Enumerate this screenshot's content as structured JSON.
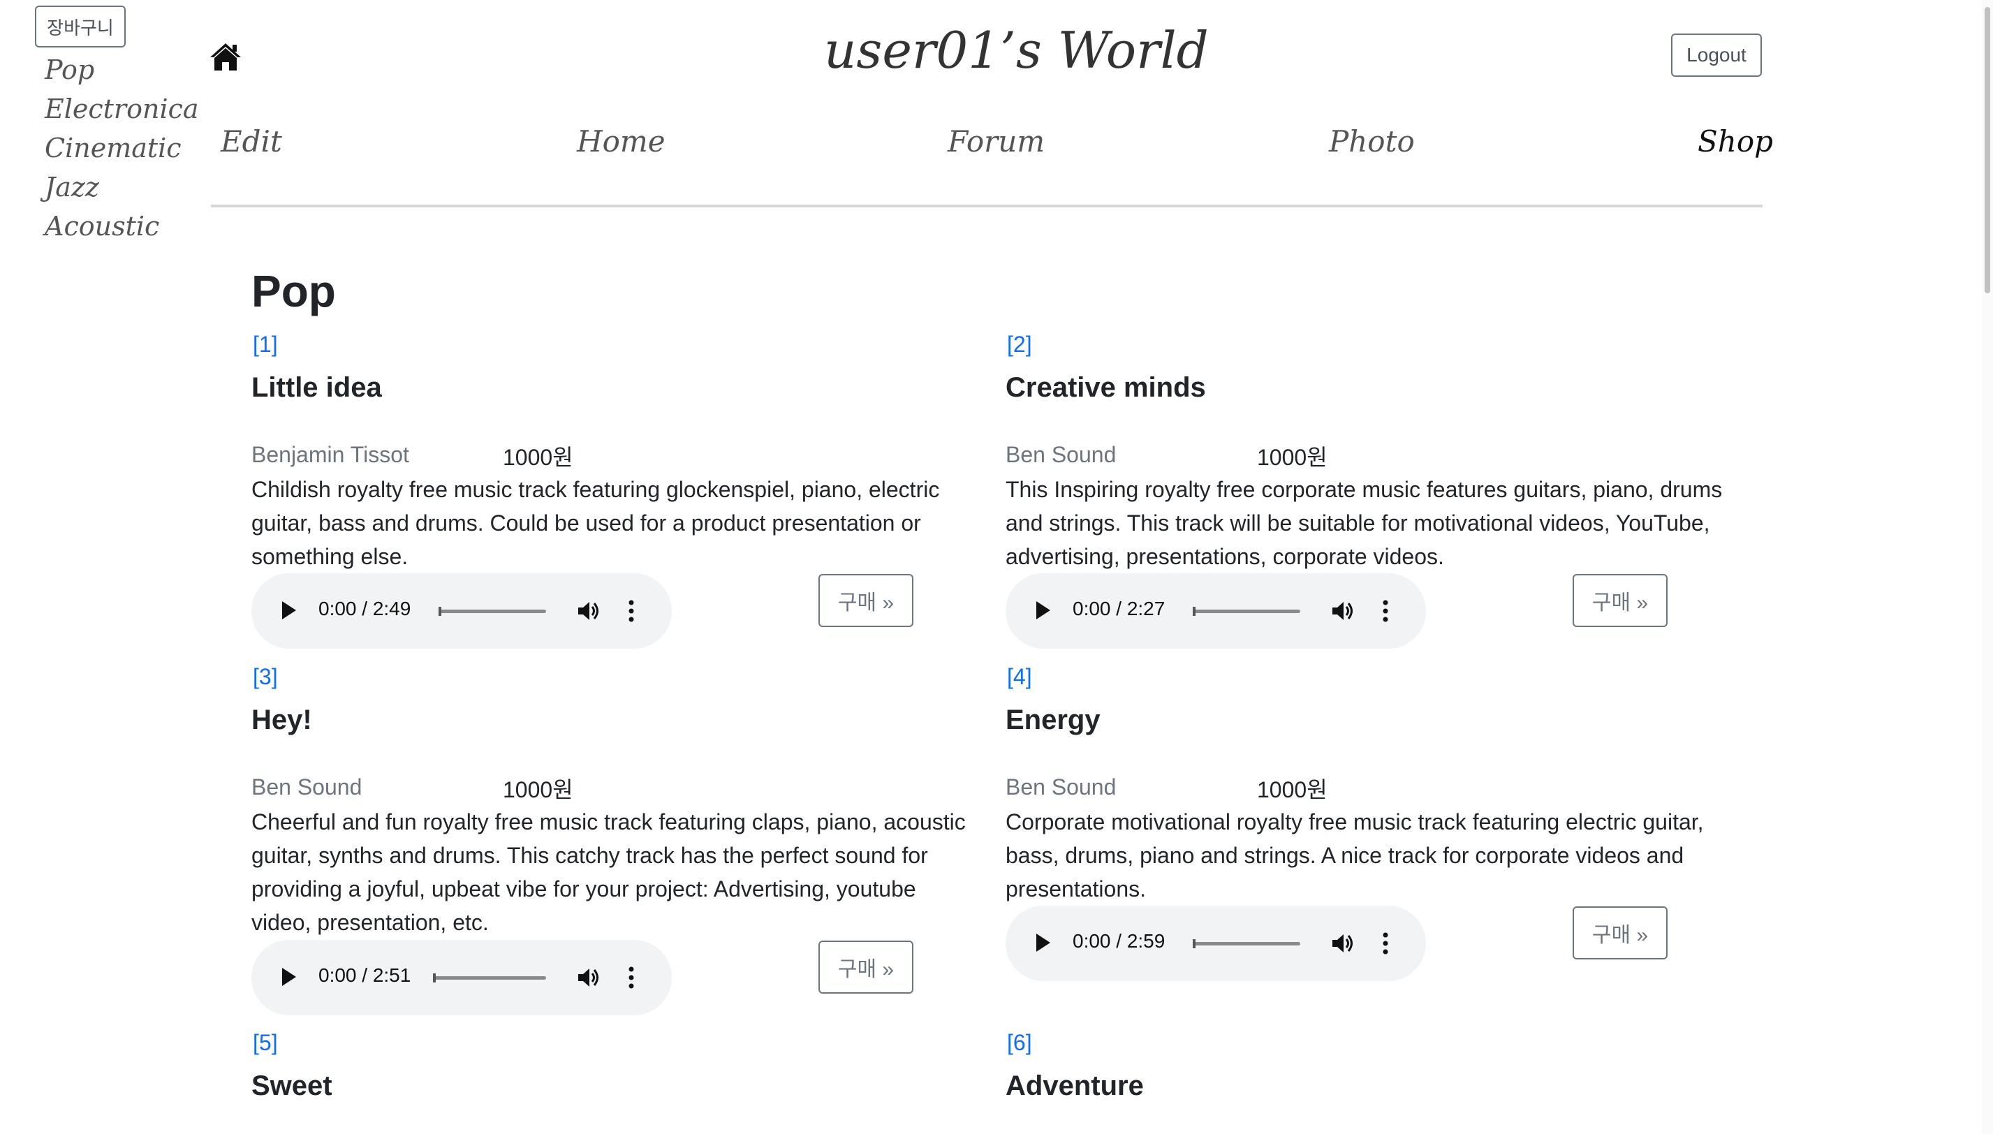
{
  "sidebar": {
    "cart_label": "장바구니",
    "genres": [
      "Pop",
      "Electronica",
      "Cinematic",
      "Jazz",
      "Acoustic"
    ]
  },
  "header": {
    "title": "user01’s World",
    "logout_label": "Logout",
    "home_icon": "home-icon",
    "nav": [
      "Edit",
      "Home",
      "Forum",
      "Photo",
      "Shop"
    ],
    "active_nav": "Shop"
  },
  "main": {
    "section_title": "Pop",
    "tracks": [
      {
        "num": "[1]",
        "title": "Little idea",
        "artist": "Benjamin Tissot",
        "price": "1000원",
        "description": "Childish royalty free music track featuring glockenspiel, piano, electric guitar, bass and drums. Could be used for a product presentation or something else.",
        "time": "0:00 / 2:49",
        "progress": 0,
        "buy_label": "구매 »"
      },
      {
        "num": "[2]",
        "title": "Creative minds",
        "artist": "Ben Sound",
        "price": "1000원",
        "description": "This Inspiring royalty free corporate music features guitars, piano, drums and strings. This track will be suitable for motivational videos, YouTube, advertising, presentations, corporate videos.",
        "time": "0:00 / 2:27",
        "progress": 0,
        "buy_label": "구매 »"
      },
      {
        "num": "[3]",
        "title": "Hey!",
        "artist": "Ben Sound",
        "price": "1000원",
        "description": "Cheerful and fun royalty free music track featuring claps, piano, acoustic guitar, synths and drums. This catchy track has the perfect sound for providing a joyful, upbeat vibe for your project: Advertising, youtube video, presentation, etc.",
        "time": "0:00 / 2:51",
        "progress": 0,
        "buy_label": "구매 »"
      },
      {
        "num": "[4]",
        "title": "Energy",
        "artist": "Ben Sound",
        "price": "1000원",
        "description": "Corporate motivational royalty free music track featuring electric guitar, bass, drums, piano and strings. A nice track for corporate videos and presentations.",
        "time": "0:00 / 2:59",
        "progress": 0,
        "buy_label": "구매 »"
      },
      {
        "num": "[5]",
        "title": "Sweet"
      },
      {
        "num": "[6]",
        "title": "Adventure"
      }
    ]
  },
  "colors": {
    "link_blue": "#0d6efd",
    "muted_gray": "#6c757d",
    "player_bg": "#f1f3f4"
  }
}
